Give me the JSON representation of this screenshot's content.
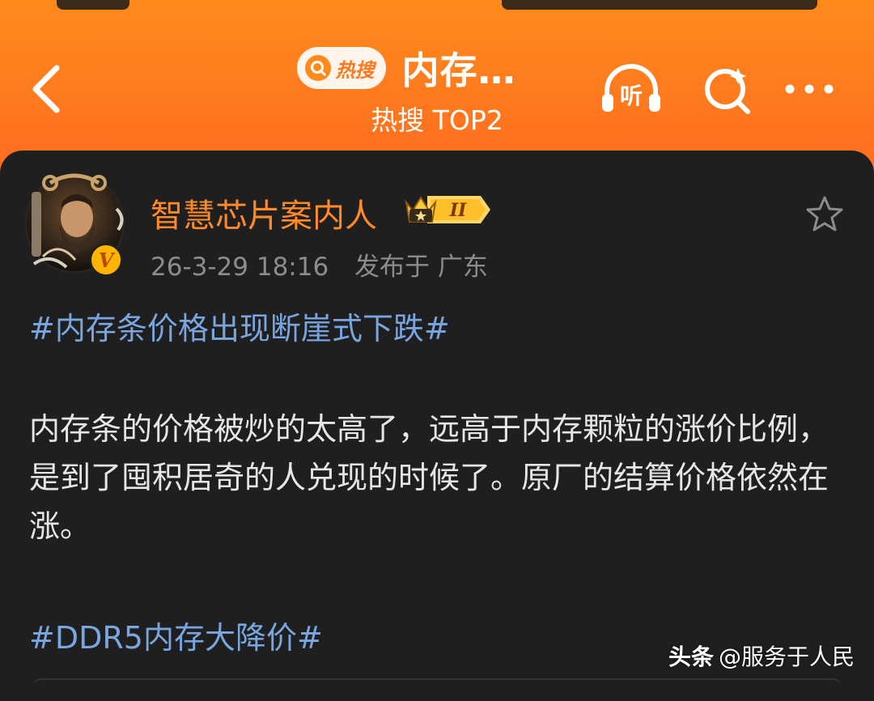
{
  "header": {
    "hot_badge": "热搜",
    "title": "内存…",
    "subtitle": "热搜 TOP2",
    "listen_label": "听"
  },
  "post": {
    "author": "智慧芯片案内人",
    "level": "II",
    "timestamp": "26-3-29 18:16",
    "published_label": "发布于",
    "location": "广东",
    "hashtag_1": "#内存条价格出现断崖式下跌#",
    "body": "内存条的价格被炒的太高了，远高于内存颗粒的涨价比例，是到了囤积居奇的人兑现的时候了。原厂的结算价格依然在涨。",
    "hashtag_2": "#DDR5内存大降价#"
  },
  "watermark": {
    "brand": "头条",
    "handle": "@服务于人民"
  },
  "icons": {
    "back": "back-chevron-icon",
    "listen": "listen-headphone-icon",
    "search": "search-icon",
    "more": "more-dots-icon",
    "favorite": "star-outline-icon",
    "verified": "verified-v-icon",
    "level": "crown-level-icon"
  },
  "colors": {
    "header_orange": "#ff7a1e",
    "card_bg": "#1f1f1f",
    "username": "#ff8a2a",
    "hashtag": "#7aa6e0",
    "body_text": "#e6e6e6",
    "meta_text": "#8c8c8c"
  }
}
